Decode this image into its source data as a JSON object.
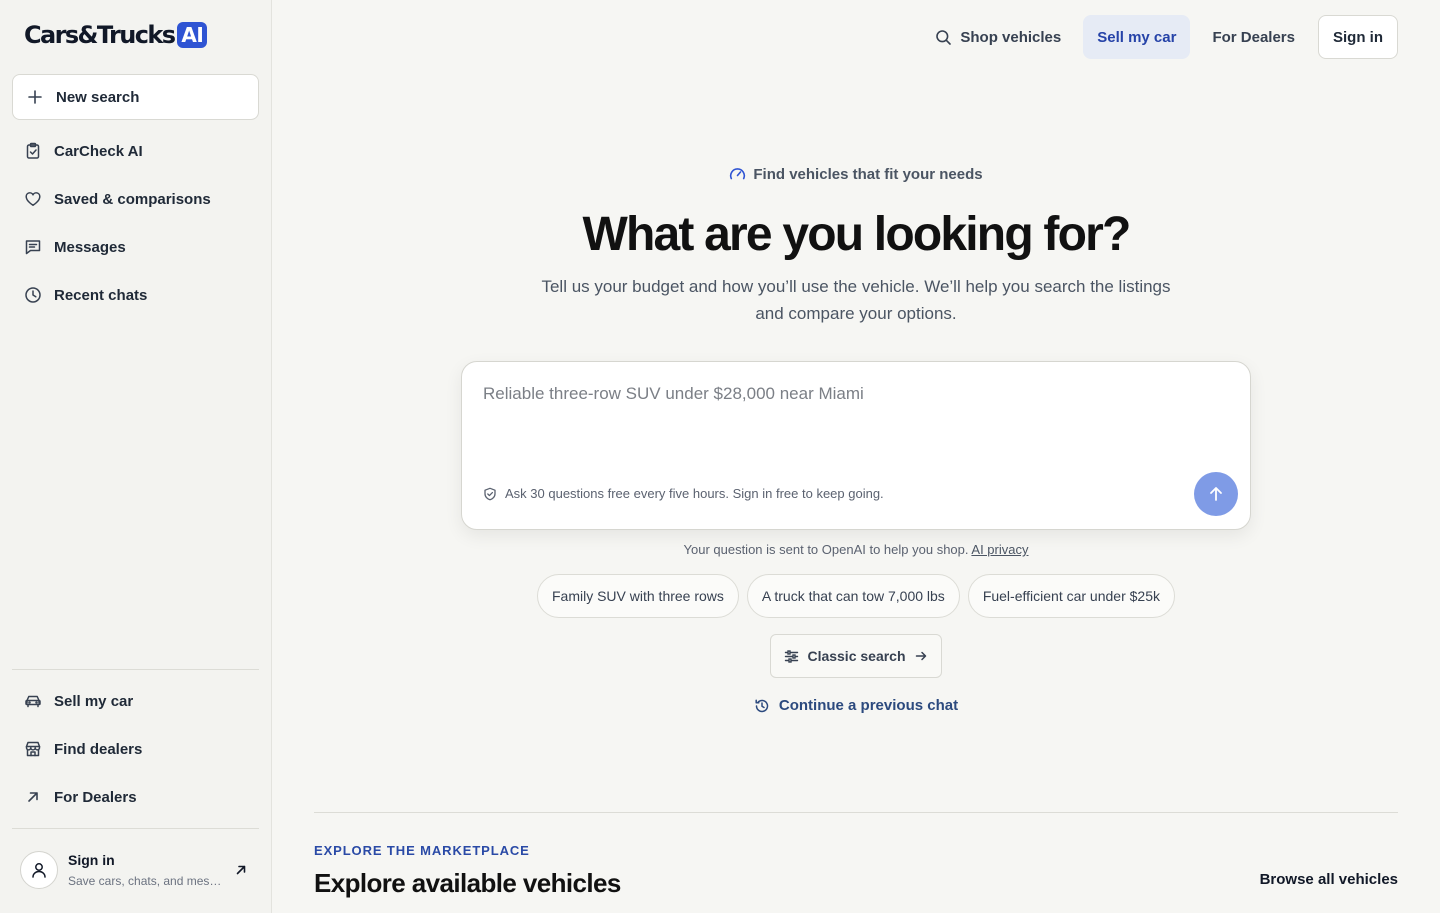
{
  "brand": {
    "name": "Cars&Trucks",
    "badge": "AI",
    "accent_color": "#2f54d3"
  },
  "sidebar": {
    "new_search_label": "New search",
    "items": [
      {
        "label": "CarCheck AI",
        "icon": "clipboard-check-icon"
      },
      {
        "label": "Saved & comparisons",
        "icon": "heart-icon"
      },
      {
        "label": "Messages",
        "icon": "message-icon"
      },
      {
        "label": "Recent chats",
        "icon": "clock-icon"
      }
    ],
    "bottom_items": [
      {
        "label": "Sell my car",
        "icon": "car-icon"
      },
      {
        "label": "Find dealers",
        "icon": "store-icon"
      },
      {
        "label": "For Dealers",
        "icon": "arrow-up-right-icon"
      }
    ],
    "account": {
      "title": "Sign in",
      "subtitle": "Save cars, chats, and messages"
    }
  },
  "topnav": {
    "shop": "Shop vehicles",
    "sell": "Sell my car",
    "dealers": "For Dealers",
    "signin": "Sign in"
  },
  "hero": {
    "kicker": "Find vehicles that fit your needs",
    "title": "What are you looking for?",
    "subtitle": "Tell us your budget and how you’ll use the vehicle. We’ll help you search the listings and compare your options."
  },
  "prompt": {
    "placeholder": "Reliable three-row SUV under $28,000 near Miami",
    "quota_note": "Ask 30 questions free every five hours. Sign in free to keep going.",
    "privacy_text": "Your question is sent to OpenAI to help you shop.",
    "privacy_link": "AI privacy"
  },
  "suggestions": [
    "Family SUV with three rows",
    "A truck that can tow 7,000 lbs",
    "Fuel-efficient car under $25k"
  ],
  "classic_search": "Classic search",
  "continue_chat": "Continue a previous chat",
  "explore": {
    "kicker": "EXPLORE THE MARKETPLACE",
    "title": "Explore available vehicles",
    "browse": "Browse all vehicles"
  }
}
